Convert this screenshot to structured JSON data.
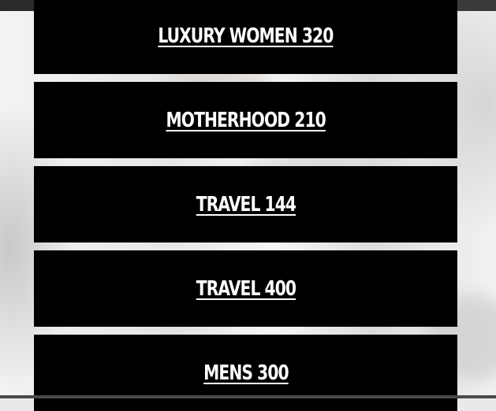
{
  "colors": {
    "card_background": "#000000",
    "card_text": "#ffffff",
    "top_bar": "#3a3a3a"
  },
  "categories": [
    {
      "label": "LUXURY WOMEN 320"
    },
    {
      "label": "MOTHERHOOD 210"
    },
    {
      "label": "TRAVEL 144"
    },
    {
      "label": "TRAVEL 400"
    },
    {
      "label": "MENS 300"
    }
  ]
}
